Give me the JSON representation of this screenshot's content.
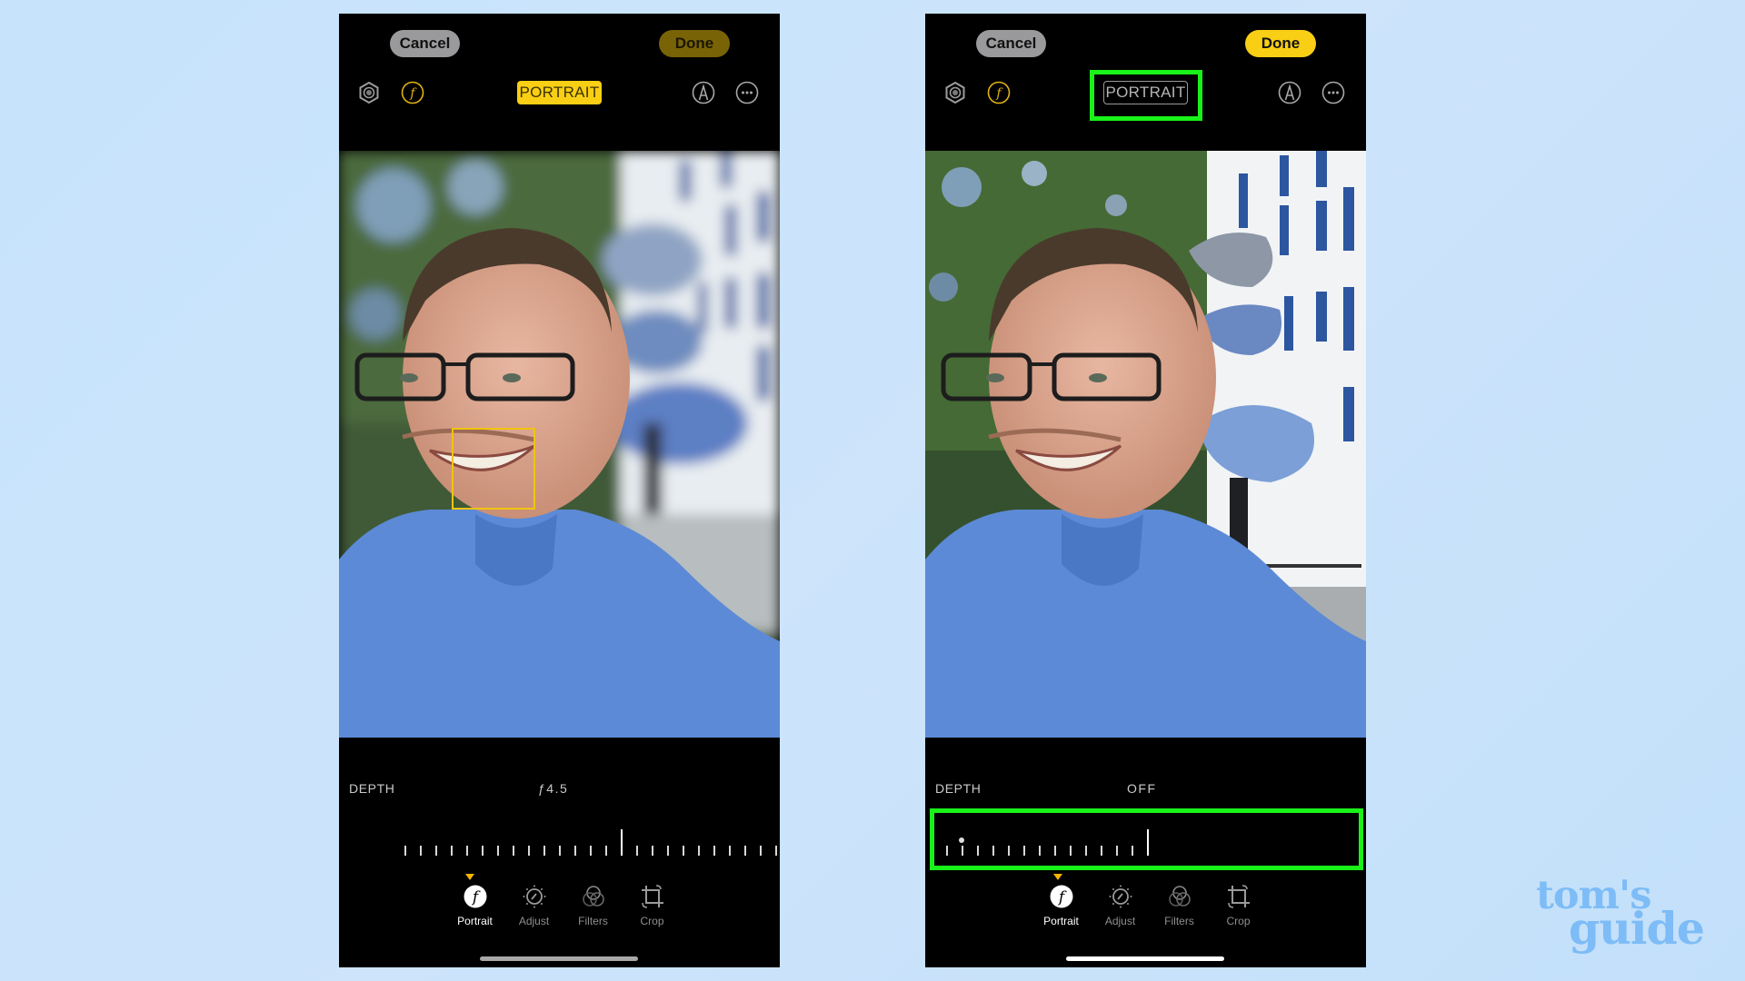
{
  "background_color": "#c6e3fb",
  "accent_yellow": "#f8cf14",
  "highlight_green": "#19f219",
  "phones": [
    {
      "id": "before",
      "header": {
        "cancel_label": "Cancel",
        "done_label": "Done",
        "done_state": "dimmed",
        "portrait_label": "PORTRAIT",
        "portrait_state": "on"
      },
      "icons": {
        "live": "live-photo-icon",
        "aperture": "f-stop-icon",
        "markup": "markup-pen-icon",
        "more": "more-ellipsis-icon"
      },
      "photo": {
        "subject": "Smiling man with glasses and blue shirt, background blurred",
        "background_blur": true,
        "focus_box_visible": true
      },
      "depth": {
        "label": "DEPTH",
        "value": "ƒ4.5",
        "tick_count": 28,
        "center_index": 14
      },
      "tabs": [
        {
          "label": "Portrait",
          "icon": "portrait-f-icon",
          "active": true
        },
        {
          "label": "Adjust",
          "icon": "adjust-dial-icon",
          "active": false
        },
        {
          "label": "Filters",
          "icon": "filters-circles-icon",
          "active": false
        },
        {
          "label": "Crop",
          "icon": "crop-rotate-icon",
          "active": false
        }
      ]
    },
    {
      "id": "after",
      "header": {
        "cancel_label": "Cancel",
        "done_label": "Done",
        "done_state": "active",
        "portrait_label": "PORTRAIT",
        "portrait_state": "off"
      },
      "icons": {
        "live": "live-photo-icon",
        "aperture": "f-stop-icon",
        "markup": "markup-pen-icon",
        "more": "more-ellipsis-icon"
      },
      "photo": {
        "subject": "Smiling man with glasses and blue shirt, background sharp",
        "background_blur": false,
        "focus_box_visible": false
      },
      "depth": {
        "label": "DEPTH",
        "value": "OFF",
        "tick_count": 14,
        "center_index": 13
      },
      "tabs": [
        {
          "label": "Portrait",
          "icon": "portrait-f-icon",
          "active": true
        },
        {
          "label": "Adjust",
          "icon": "adjust-dial-icon",
          "active": false
        },
        {
          "label": "Filters",
          "icon": "filters-circles-icon",
          "active": false
        },
        {
          "label": "Crop",
          "icon": "crop-rotate-icon",
          "active": false
        }
      ],
      "highlights": [
        "portrait-toggle",
        "depth-slider"
      ]
    }
  ],
  "watermark": {
    "line1": "tom's",
    "line2": "guide"
  }
}
